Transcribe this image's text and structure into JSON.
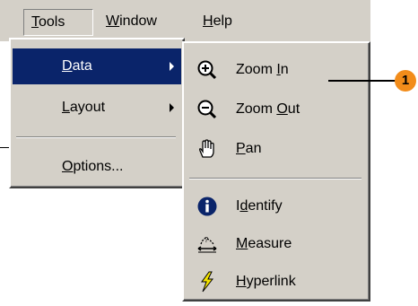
{
  "menubar": {
    "tools": {
      "pre": "",
      "u": "T",
      "post": "ools"
    },
    "window": {
      "pre": "",
      "u": "W",
      "post": "indow"
    },
    "help": {
      "pre": "",
      "u": "H",
      "post": "elp"
    }
  },
  "tools_menu": {
    "items": [
      {
        "pre": "",
        "u": "D",
        "post": "ata",
        "selected": true,
        "has_submenu": true
      },
      {
        "pre": "",
        "u": "L",
        "post": "ayout",
        "selected": false,
        "has_submenu": true
      },
      {
        "pre": "",
        "u": "O",
        "post": "ptions...",
        "selected": false,
        "has_submenu": false
      }
    ]
  },
  "data_submenu": {
    "items": [
      {
        "icon": "zoom-in-icon",
        "pre": "Zoom ",
        "u": "I",
        "post": "n"
      },
      {
        "icon": "zoom-out-icon",
        "pre": "Zoom ",
        "u": "O",
        "post": "ut"
      },
      {
        "icon": "pan-hand-icon",
        "pre": "",
        "u": "P",
        "post": "an"
      },
      {
        "icon": "identify-icon",
        "pre": "I",
        "u": "d",
        "post": "entify"
      },
      {
        "icon": "measure-icon",
        "pre": "",
        "u": "M",
        "post": "easure"
      },
      {
        "icon": "hyperlink-icon",
        "pre": "",
        "u": "H",
        "post": "yperlink"
      }
    ]
  },
  "callout": {
    "number": "1",
    "color": "#f28c1a"
  },
  "colors": {
    "menu_bg": "#d4d0c8",
    "selection": "#0a246a"
  }
}
